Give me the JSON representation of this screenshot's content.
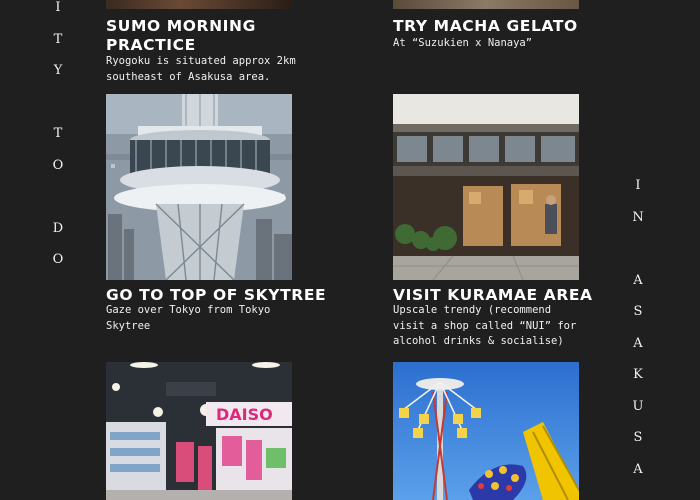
{
  "left_vertical": [
    "I",
    "T",
    "Y",
    "",
    "T",
    "O",
    "",
    "D",
    "O"
  ],
  "right_vertical": [
    "I",
    "N",
    "",
    "A",
    "S",
    "A",
    "K",
    "U",
    "S",
    "A"
  ],
  "cards": {
    "sumo": {
      "title_line1": "SUMO MORNING",
      "title_line2": "PRACTICE",
      "desc": "Ryogoku is situated approx 2km\nsoutheast of Asakusa area."
    },
    "macha": {
      "title": "TRY MACHA GELATO",
      "desc": "At “Suzukien x Nanaya”"
    },
    "skytree": {
      "title": "GO TO TOP OF SKYTREE",
      "desc": "Gaze over Tokyo from Tokyo\nSkytree"
    },
    "kuramae": {
      "title": "VISIT KURAMAE AREA",
      "desc": "Upscale trendy (recommend\nvisit a shop called “NUI” for\nalcohol drinks & socialise)"
    },
    "daiso": {
      "sign": "DAISO"
    }
  }
}
